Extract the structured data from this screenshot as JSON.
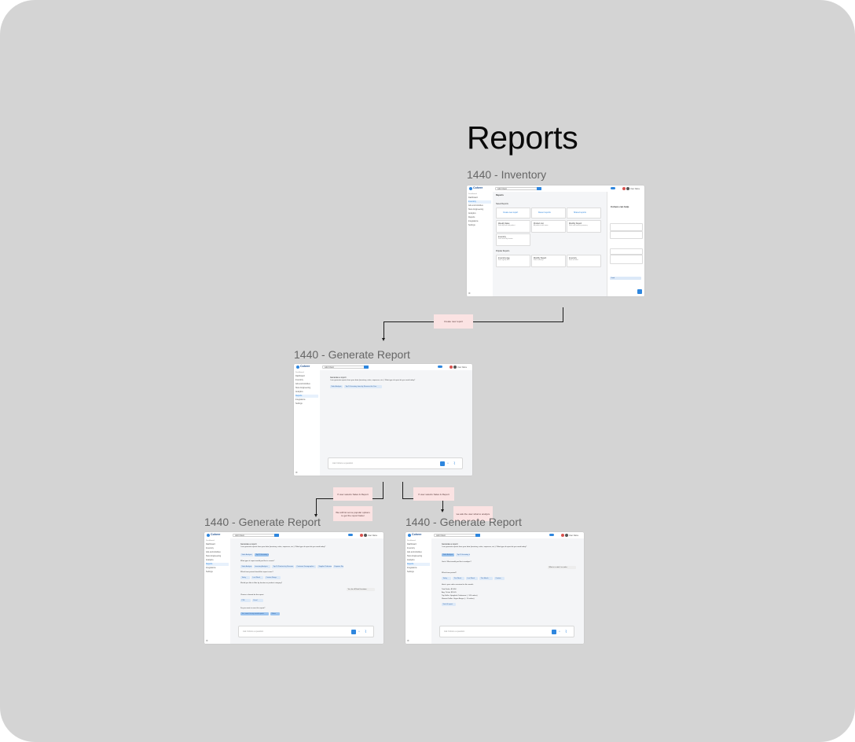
{
  "section_title": "Reports",
  "frames": [
    {
      "label": "1440 - Inventory"
    },
    {
      "label": "1440 - Generate Report"
    },
    {
      "label": "1440 - Generate Report"
    },
    {
      "label": "1440 - Generate Report"
    }
  ],
  "app": {
    "logo": "Cohere",
    "client_placeholder": "Add Client",
    "user": "User Name",
    "sidebar_label": "Dashboard",
    "sidebar_items": [
      "Dashboard",
      "Inventory",
      "Ads and Activities",
      "Store Engineering",
      "Analytics",
      "Reports",
      "Integrations",
      "Settings"
    ]
  },
  "inventory_frame": {
    "page_title": "Reports",
    "section1": "Saved Reports",
    "create_actions": [
      "Create new report",
      "Recent reports",
      "Shared reports"
    ],
    "saved_cards": [
      {
        "title": "Weekly Sales",
        "sub": "Sales by week and product"
      },
      {
        "title": "Product List",
        "sub": "All products with status"
      },
      {
        "title": "Monthly Report",
        "sub": "Sales and inventory summary"
      },
      {
        "title": "Inventory",
        "sub": "Stock levels by location"
      }
    ],
    "section2": "Popular Reports",
    "popular_cards": [
      {
        "title": "Inventory Age",
        "sub": "Stock age by SKU"
      },
      {
        "title": "Monthly Report",
        "sub": "Sales summary"
      },
      {
        "title": "Inventory",
        "sub": "Stock on hand"
      }
    ],
    "panel_title": "Cohere can help",
    "panel_send": "Send"
  },
  "generate_frame": {
    "greeting": "Generate a report",
    "prompt": "I can generate reports from your data (inventory, sales, expenses, etc.). What type of report do you need today?",
    "chips": [
      "Sales Analysis",
      "Top 10 Inventory items by Revenue this Year"
    ],
    "input_placeholder": "Ask Cohere a question"
  },
  "left_frame": {
    "q1": "What type of report would you like to create?",
    "types": [
      "Sales Analysis",
      "Inventory Analysis",
      "Top 10 Products by Revenue",
      "Customer Demographics",
      "Supplier Performance",
      "Expense Report"
    ],
    "q2": "Which time period should the report cover?",
    "periods": [
      "Today",
      "Last Week",
      "Custom Range"
    ],
    "q3": "Would you like to filter by location or product category?",
    "reply": "Yes, for all Retail Locations",
    "q4": "Choose a format for the report",
    "formats": [
      "PDF",
      "Excel"
    ],
    "q5": "Do you want to save this report?",
    "save_options": [
      "Yes, save it to my saved reports",
      "Share"
    ],
    "input_placeholder": "Ask Cohere a question"
  },
  "right_frame": {
    "q1": "Got it. What would you like to analyze?",
    "reply": "What is in stock / on sales",
    "q2": "Which time period?",
    "periods": [
      "Today",
      "This Week",
      "Last Week",
      "This Month",
      "Custom"
    ],
    "summary_title": "Here's your sales overview for this month:",
    "summary_lines": [
      "Total Sales: $2,450",
      "Avg. Ticket: $20.45",
      "Top Seller: Spaghetti Carbonara (~ 105 orders)",
      "Slowest Seller: Vegan Burger (~ 11 orders)"
    ],
    "followup": "See full report",
    "input_placeholder": "Ask Cohere a question"
  },
  "notes": [
    "Create new report",
    "If user selects Sales & Report",
    "We will list some popular options to get the report faster",
    "If user selects Sales & Report",
    "we ask the user what to analyze"
  ]
}
